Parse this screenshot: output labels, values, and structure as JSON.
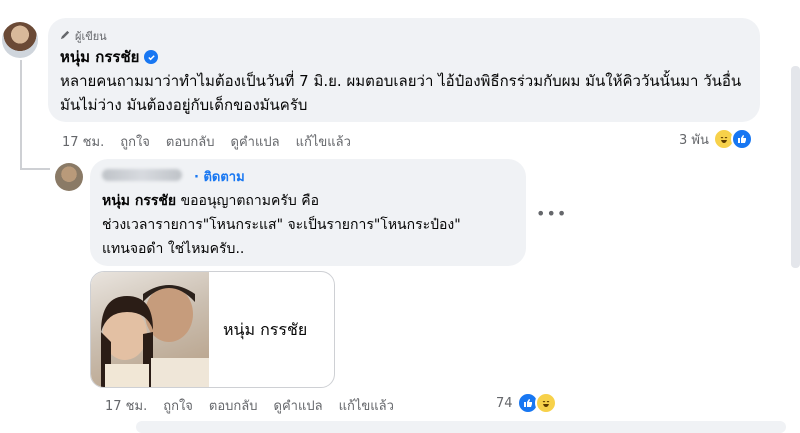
{
  "comment": {
    "author_badge": "ผู้เขียน",
    "author": "หนุ่ม กรรชัย",
    "text": "หลายคนถามมาว่าทำไมต้องเป็นวันที่ 7 มิ.ย. ผมตอบเลยว่า ไอ้ป๋องพิธีกรร่วมกับผม มันให้คิววันนั้นมา วันอื่นมันไม่ว่าง มันต้องอยู่กับเด็กของมันครับ",
    "actions": {
      "time": "17 ชม.",
      "like": "ถูกใจ",
      "reply": "ตอบกลับ",
      "translate": "ดูคำแปล",
      "edited": "แก้ไขแล้ว"
    },
    "reaction_count": "3 พัน"
  },
  "reply": {
    "follow": "ติดตาม",
    "mention": "หนุ่ม กรรชัย",
    "text_after_mention": " ขออนุญาตถามครับ คือ",
    "line2": "ช่วงเวลารายการ\"โหนกระแส\" จะเป็นรายการ\"โหนกระป๋อง\"",
    "line3": "แทนจอดำ ใช่ไหมครับ..",
    "more": "•••",
    "card_title": "หนุ่ม กรรชัย",
    "actions": {
      "time": "17 ชม.",
      "like": "ถูกใจ",
      "reply": "ตอบกลับ",
      "translate": "ดูคำแปล",
      "edited": "แก้ไขแล้ว"
    },
    "reaction_count": "74"
  },
  "icons": {
    "pencil": "pencil-icon",
    "verified": "verified-badge-icon",
    "like": "like-reaction-icon",
    "haha": "haha-reaction-icon"
  },
  "colors": {
    "accent": "#1877f2",
    "bubble": "#f0f2f5",
    "muted": "#65676b"
  }
}
